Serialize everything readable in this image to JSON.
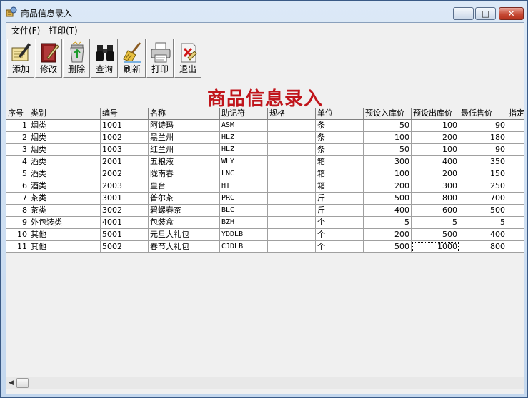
{
  "window": {
    "title": "商品信息录入"
  },
  "window_controls": {
    "min": "–",
    "max": "□",
    "close": "✕"
  },
  "menu": [
    {
      "label": "文件(F)"
    },
    {
      "label": "打印(T)"
    }
  ],
  "toolbar": {
    "add": "添加",
    "edit": "修改",
    "delete": "删除",
    "query": "查询",
    "refresh": "刷新",
    "print": "打印",
    "exit": "退出"
  },
  "heading": "商品信息录入",
  "table": {
    "columns": [
      "序号",
      "类别",
      "编号",
      "名称",
      "助记符",
      "规格",
      "单位",
      "预设入库价",
      "预设出库价",
      "最低售价",
      "指定"
    ],
    "rows": [
      [
        "1",
        "烟类",
        "1001",
        "阿诗玛",
        "ASM",
        "",
        "条",
        "50",
        "100",
        "90",
        ""
      ],
      [
        "2",
        "烟类",
        "1002",
        "黑兰州",
        "HLZ",
        "",
        "条",
        "100",
        "200",
        "180",
        ""
      ],
      [
        "3",
        "烟类",
        "1003",
        "红兰州",
        "HLZ",
        "",
        "条",
        "50",
        "100",
        "90",
        ""
      ],
      [
        "4",
        "酒类",
        "2001",
        "五粮液",
        "WLY",
        "",
        "箱",
        "300",
        "400",
        "350",
        ""
      ],
      [
        "5",
        "酒类",
        "2002",
        "陇南春",
        "LNC",
        "",
        "箱",
        "100",
        "200",
        "150",
        ""
      ],
      [
        "6",
        "酒类",
        "2003",
        "皇台",
        "HT",
        "",
        "箱",
        "200",
        "300",
        "250",
        ""
      ],
      [
        "7",
        "茶类",
        "3001",
        "普尔茶",
        "PRC",
        "",
        "斤",
        "500",
        "800",
        "700",
        ""
      ],
      [
        "8",
        "茶类",
        "3002",
        "碧螺春茶",
        "BLC",
        "",
        "斤",
        "400",
        "600",
        "500",
        ""
      ],
      [
        "9",
        "外包装类",
        "4001",
        "包装盒",
        "BZH",
        "",
        "个",
        "5",
        "5",
        "5",
        ""
      ],
      [
        "10",
        "其他",
        "5001",
        "元旦大礼包",
        "YDDLB",
        "",
        "个",
        "200",
        "500",
        "400",
        ""
      ],
      [
        "11",
        "其他",
        "5002",
        "春节大礼包",
        "CJDLB",
        "",
        "个",
        "500",
        "1000",
        "800",
        ""
      ]
    ]
  },
  "scrollbar": {
    "left_arrow": "◀"
  }
}
